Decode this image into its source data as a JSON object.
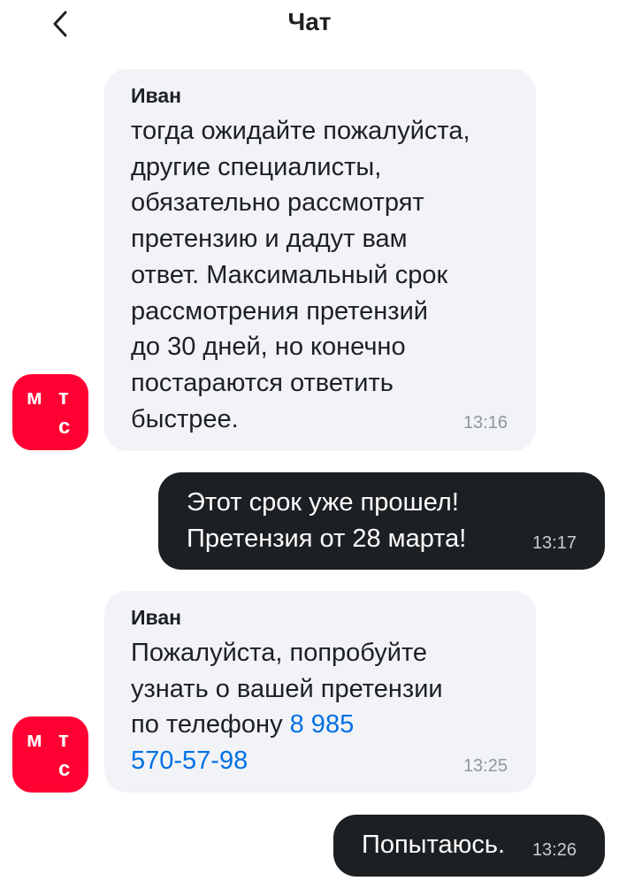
{
  "header": {
    "title": "Чат",
    "back_icon": "chevron-left-icon"
  },
  "brand": {
    "name": "МТС",
    "logo_letters": [
      "м",
      "т",
      "с"
    ],
    "color": "#ff0032"
  },
  "messages": [
    {
      "direction": "incoming",
      "sender": "Иван",
      "text": "тогда ожидайте пожалуйста,\nдругие специалисты,\nобязательно рассмотрят\nпретензию и дадут вам\nответ. Максимальный срок\nрассмотрения претензий\nдо 30 дней, но конечно\nпостараются ответить\nбыстрее.",
      "time": "13:16"
    },
    {
      "direction": "outgoing",
      "text": "Этот срок уже прошел!\nПретензия от 28 марта!",
      "time": "13:17"
    },
    {
      "direction": "incoming",
      "sender": "Иван",
      "text": "Пожалуйста, попробуйте\nузнать о вашей претензии\nпо телефону ",
      "phone": "8 985\n570-57-98",
      "time": "13:25"
    },
    {
      "direction": "outgoing",
      "text": "Попытаюсь.",
      "time": "13:26"
    }
  ],
  "colors": {
    "incoming_bubble": "#f2f3f7",
    "outgoing_bubble": "#1d2023",
    "link": "#0070e5",
    "timestamp": "#8d969f"
  }
}
